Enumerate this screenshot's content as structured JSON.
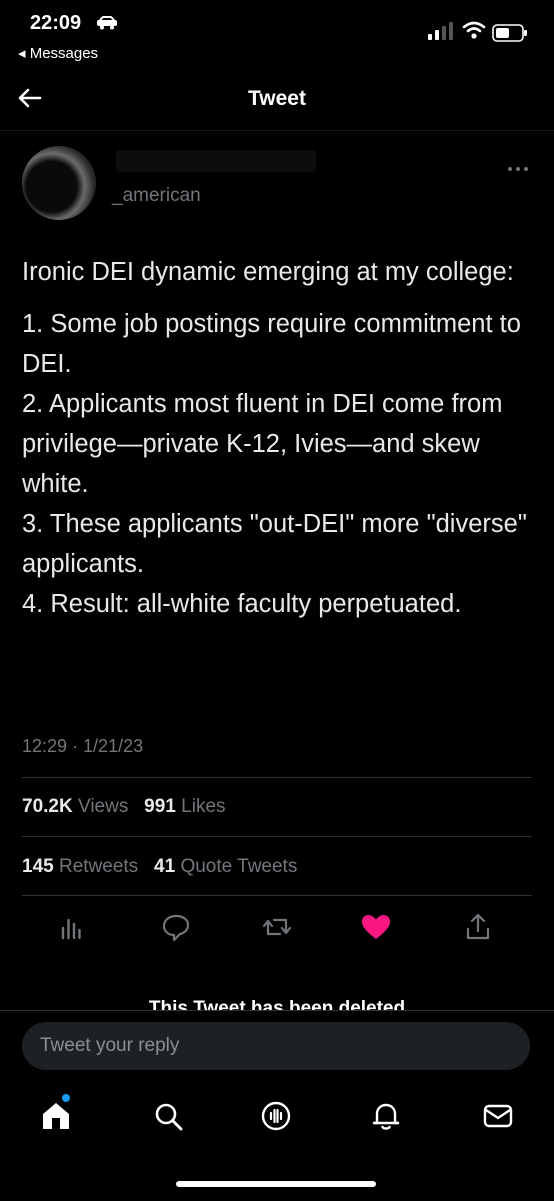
{
  "status_bar": {
    "time": "22:09",
    "back_app": "◂ Messages"
  },
  "header": {
    "title": "Tweet"
  },
  "author": {
    "handle": "_american"
  },
  "tweet": {
    "intro": "Ironic DEI dynamic emerging at my college:",
    "lines": [
      "1. Some job postings require commitment to DEI.",
      "2. Applicants most fluent in DEI come from privilege—private K-12, Ivies—and skew white.",
      "3. These applicants \"out-DEI\" more \"diverse\" applicants.",
      "4. Result: all-white faculty perpetuated."
    ],
    "timestamp": "12:29 · 1/21/23"
  },
  "stats": {
    "views_count": "70.2K",
    "views_label": "Views",
    "likes_count": "991",
    "likes_label": "Likes",
    "retweets_count": "145",
    "retweets_label": "Retweets",
    "quotes_count": "41",
    "quotes_label": "Quote Tweets"
  },
  "deleted_notice": "This Tweet has been deleted",
  "reply": {
    "placeholder": "Tweet your reply"
  },
  "actions": [
    "analytics-icon",
    "reply-icon",
    "retweet-icon",
    "like-icon",
    "share-icon"
  ],
  "tab_bar": [
    "home-icon",
    "search-icon",
    "spaces-icon",
    "notifications-icon",
    "messages-icon"
  ],
  "colors": {
    "background": "#000000",
    "like": "#f91880",
    "accent": "#1d9bf0",
    "muted": "#71767b"
  }
}
